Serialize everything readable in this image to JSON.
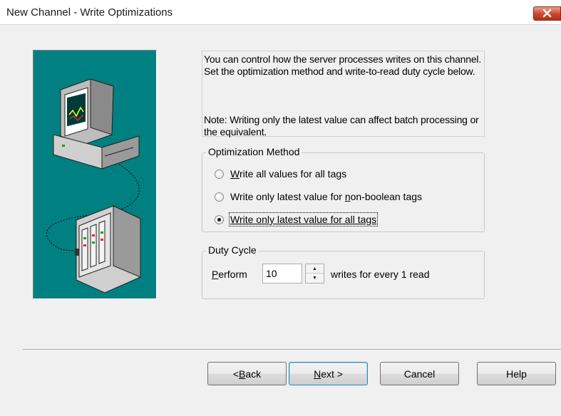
{
  "window": {
    "title": "New Channel - Write Optimizations"
  },
  "info": {
    "description": "You can control how the server processes writes on this channel.  Set the optimization method and write-to-read duty cycle below.",
    "note": "Note:  Writing only the latest value can affect batch processing or the equivalent."
  },
  "optimization": {
    "title": "Optimization Method",
    "options": [
      {
        "label": "Write all values for all tags",
        "accel_prefix": "",
        "accel": "W",
        "accel_rest": "rite all values for all tags",
        "checked": false
      },
      {
        "label": "Write only latest value for non-boolean tags",
        "accel_prefix": "Write only latest value for ",
        "accel": "n",
        "accel_rest": "on-boolean tags",
        "checked": false
      },
      {
        "label": "Write only latest value for all tags",
        "accel_prefix": "",
        "accel": "Write only latest value for all tags",
        "accel_rest": "",
        "checked": true
      }
    ]
  },
  "duty_cycle": {
    "title": "Duty Cycle",
    "perform_accel": "P",
    "perform_rest": "erform",
    "value": "10",
    "suffix": "writes for every 1 read"
  },
  "buttons": {
    "back_accel": "B",
    "back_prefix": "< ",
    "back_rest": "ack",
    "next_accel": "N",
    "next_rest": "ext >",
    "cancel": "Cancel",
    "help": "Help"
  },
  "colors": {
    "image_background": "#008080",
    "close_button": "#c9452b"
  },
  "icons": {
    "close": "close-icon",
    "image": "computer-to-device-connection-illustration"
  }
}
